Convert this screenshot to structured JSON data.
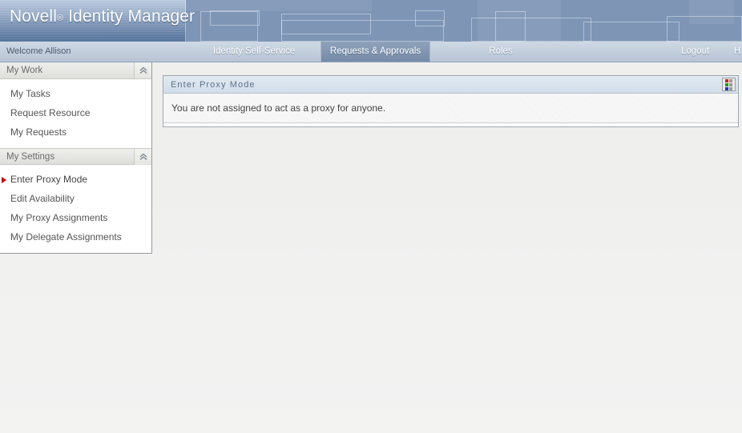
{
  "masthead": {
    "brand_name": "Novell",
    "brand_registered": "®",
    "brand_product": "Identity Manager"
  },
  "navbar": {
    "welcome": "Welcome Allison",
    "tabs": [
      {
        "label": "Identity Self-Service",
        "active": false
      },
      {
        "label": "Requests & Approvals",
        "active": true
      },
      {
        "label": "Roles",
        "active": false
      }
    ],
    "links": [
      {
        "label": "Logout"
      },
      {
        "label": "H"
      }
    ]
  },
  "sidebar": {
    "sections": [
      {
        "title": "My Work",
        "collapse_icon": "chevron-double-up-icon",
        "items": [
          {
            "label": "My Tasks",
            "selected": false
          },
          {
            "label": "Request Resource",
            "selected": false
          },
          {
            "label": "My Requests",
            "selected": false
          }
        ]
      },
      {
        "title": "My Settings",
        "collapse_icon": "chevron-double-up-icon",
        "items": [
          {
            "label": "Enter Proxy Mode",
            "selected": true
          },
          {
            "label": "Edit Availability",
            "selected": false
          },
          {
            "label": "My Proxy Assignments",
            "selected": false
          },
          {
            "label": "My Delegate Assignments",
            "selected": false
          }
        ]
      }
    ]
  },
  "panel": {
    "title": "Enter Proxy Mode",
    "icon": "color-grid-icon",
    "message": "You are not assigned to act as a proxy for anyone."
  },
  "colors": {
    "accent_marker": "#c30012",
    "masthead_blue": "#7e95b6",
    "active_tab": "#8296b1",
    "panel_title": "#5d7088",
    "icon_red": "#d02020",
    "icon_green": "#1f9b1f",
    "icon_blue": "#2233cc",
    "icon_gray": "#9a9a9a"
  }
}
